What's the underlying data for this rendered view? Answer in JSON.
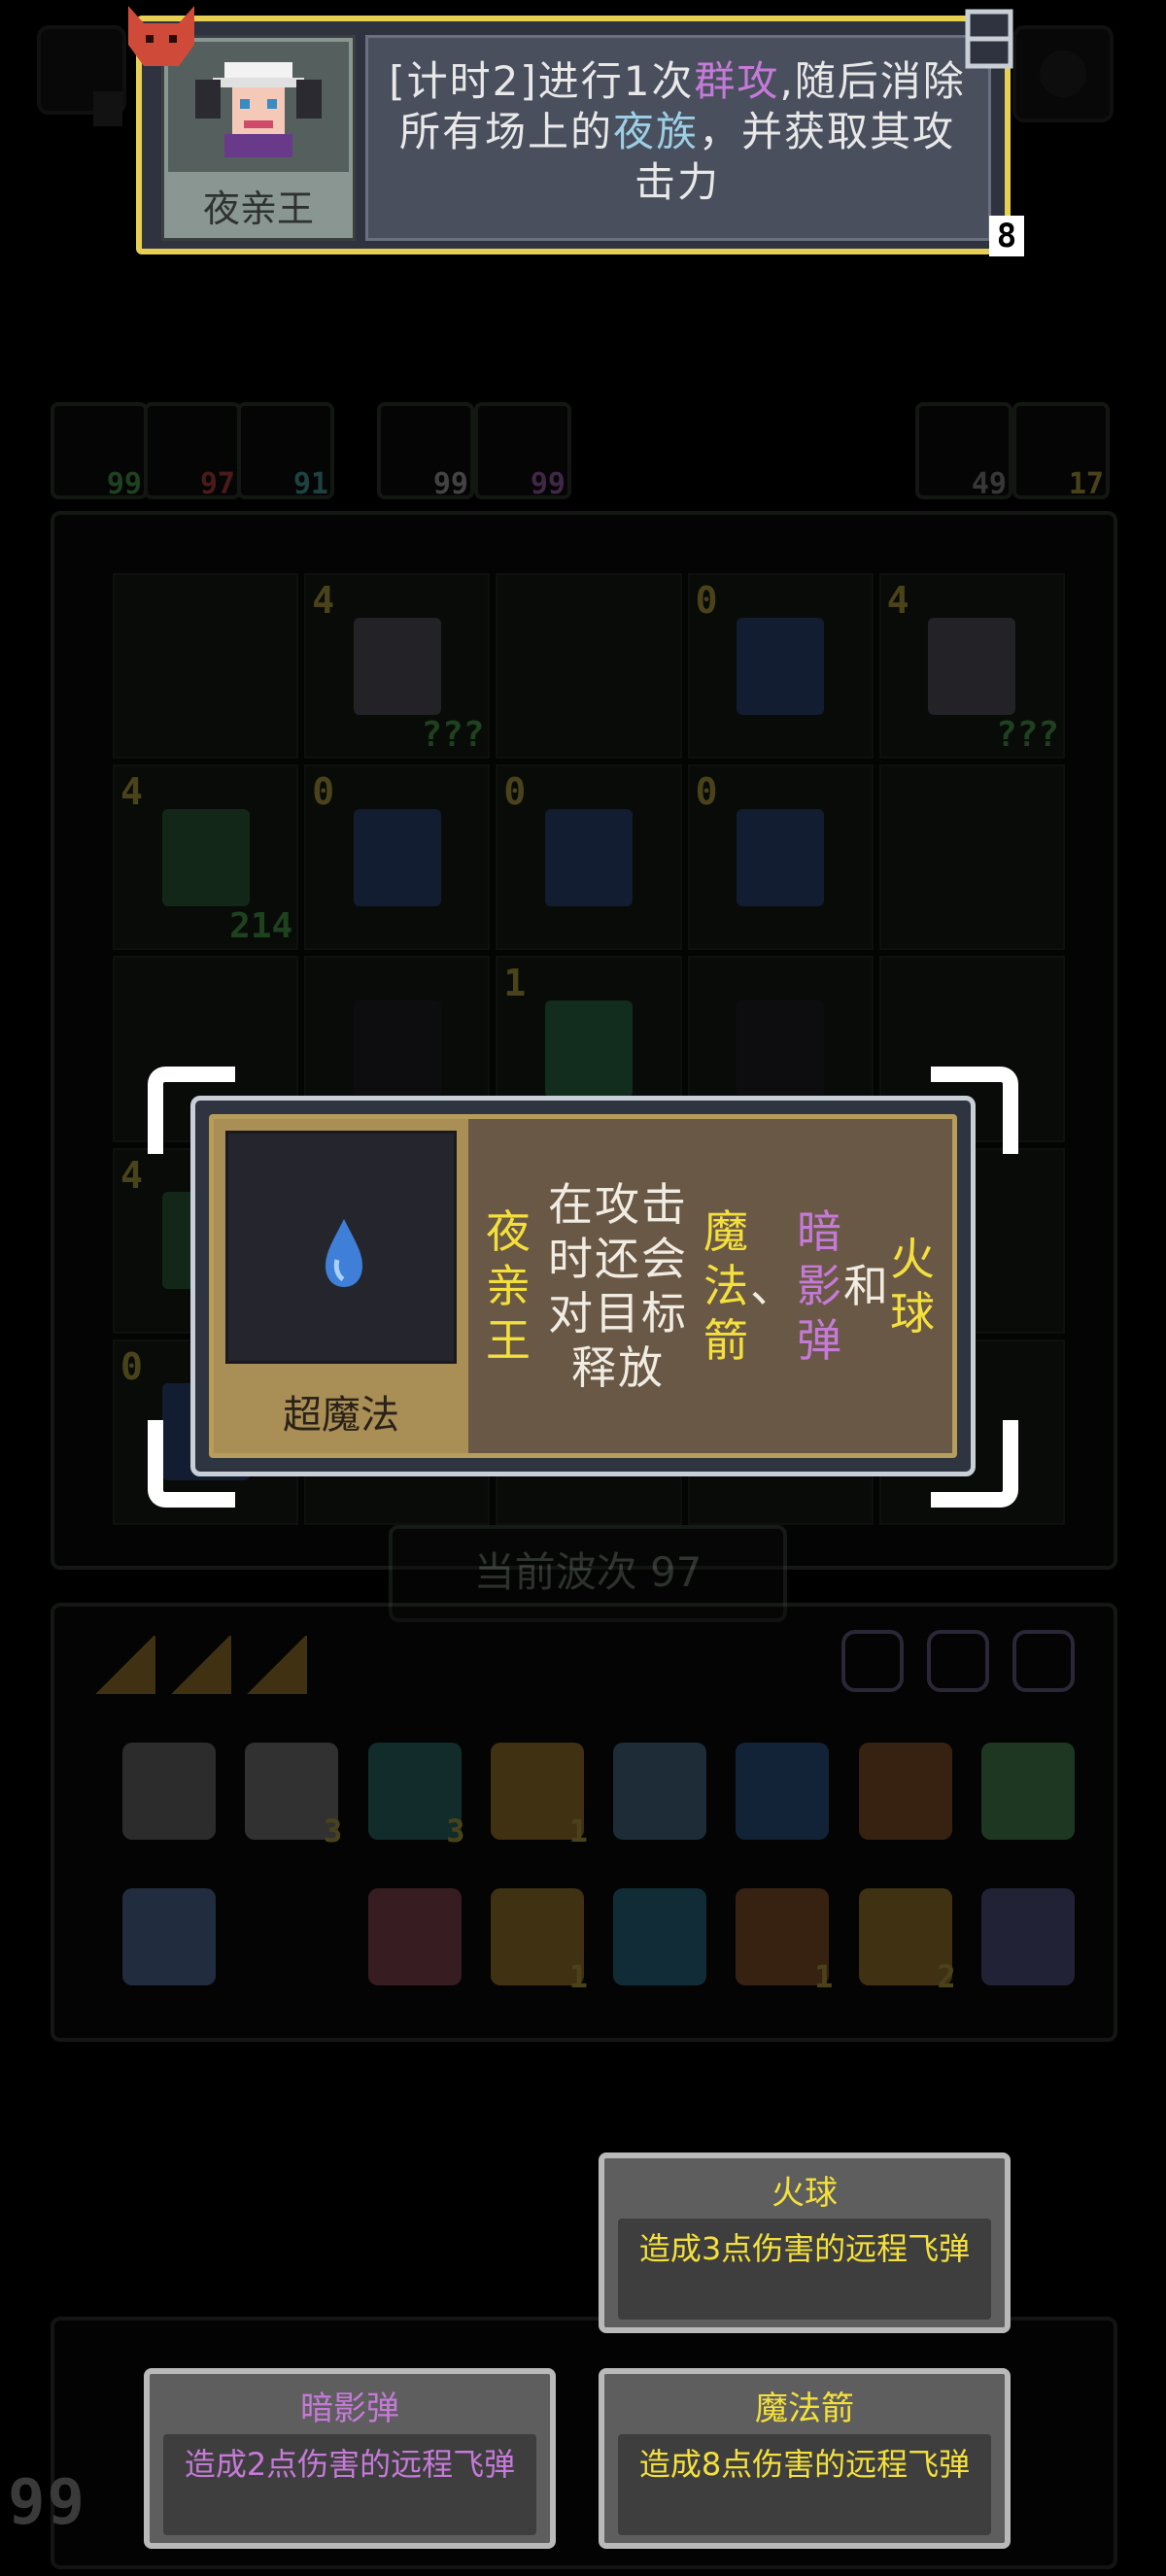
{
  "unit_card": {
    "name": "夜亲王",
    "skill_parts": [
      {
        "text": "[计时2]进行1次",
        "color": "#e8e8e8"
      },
      {
        "text": "群攻",
        "color": "#c57ad8"
      },
      {
        "text": ",随后消除所有场上的",
        "color": "#e8e8e8"
      },
      {
        "text": "夜族",
        "color": "#9ccfe4"
      },
      {
        "text": "，并获取其攻击力",
        "color": "#e8e8e8"
      }
    ],
    "corner_number": "8"
  },
  "stats": [
    {
      "value": "99",
      "color": "#5ec95e",
      "icon": "leaf-icon"
    },
    {
      "value": "97",
      "color": "#e55555",
      "icon": "plus-icon"
    },
    {
      "value": "91",
      "color": "#5ec9c9",
      "icon": "swirl-icon"
    },
    {
      "value": "99",
      "color": "#cccccc",
      "icon": "wing-icon"
    },
    {
      "value": "99",
      "color": "#c57ad8",
      "icon": "lightning-icon"
    },
    {
      "value": "49",
      "color": "#aaaaaa",
      "icon": "undo-icon"
    },
    {
      "value": "17",
      "color": "#e6cf52",
      "icon": "bolt-icon"
    }
  ],
  "board": {
    "cells": [
      {
        "lvl": "",
        "atk": "",
        "kind": "empty"
      },
      {
        "lvl": "4",
        "atk": "???",
        "kind": "knight"
      },
      {
        "lvl": "",
        "atk": "",
        "kind": "empty"
      },
      {
        "lvl": "0",
        "atk": "",
        "kind": "box"
      },
      {
        "lvl": "4",
        "atk": "???",
        "kind": "knight"
      },
      {
        "lvl": "4",
        "atk": "214",
        "kind": "knight-green"
      },
      {
        "lvl": "0",
        "atk": "",
        "kind": "box"
      },
      {
        "lvl": "0",
        "atk": "",
        "kind": "box"
      },
      {
        "lvl": "0",
        "atk": "",
        "kind": "box"
      },
      {
        "lvl": "",
        "atk": "",
        "kind": "empty"
      },
      {
        "lvl": "",
        "atk": "",
        "kind": "empty"
      },
      {
        "lvl": "",
        "atk": "",
        "kind": "shadow"
      },
      {
        "lvl": "1",
        "atk": "",
        "kind": "tower"
      },
      {
        "lvl": "",
        "atk": "",
        "kind": "shadow"
      },
      {
        "lvl": "",
        "atk": "",
        "kind": "empty"
      },
      {
        "lvl": "4",
        "atk": "",
        "kind": "knight-green"
      },
      {
        "lvl": "",
        "atk": "",
        "kind": "empty"
      },
      {
        "lvl": "",
        "atk": "",
        "kind": "empty"
      },
      {
        "lvl": "",
        "atk": "",
        "kind": "empty"
      },
      {
        "lvl": "",
        "atk": "",
        "kind": "empty"
      },
      {
        "lvl": "0",
        "atk": "",
        "kind": "box"
      },
      {
        "lvl": "",
        "atk": "",
        "kind": "empty"
      },
      {
        "lvl": "",
        "atk": "",
        "kind": "empty"
      },
      {
        "lvl": "",
        "atk": "",
        "kind": "empty"
      },
      {
        "lvl": "",
        "atk": "",
        "kind": "empty"
      }
    ]
  },
  "wave_label": "当前波次 97",
  "inventory": {
    "row1": [
      {
        "icon": "scroll-icon",
        "count": "",
        "color": "#8a8a8a"
      },
      {
        "icon": "paper-icon",
        "count": "3",
        "color": "#9a9a9a"
      },
      {
        "icon": "heart-gem-icon",
        "count": "3",
        "color": "#3a8a8a"
      },
      {
        "icon": "ring-icon",
        "count": "1",
        "color": "#c49a3a"
      },
      {
        "icon": "feather-icon",
        "count": "",
        "color": "#5a8aaa"
      },
      {
        "icon": "drop-icon",
        "count": "",
        "color": "#3a6aaa"
      },
      {
        "icon": "crown-icon",
        "count": "",
        "color": "#aa6a3a"
      },
      {
        "icon": "wand-icon",
        "count": "",
        "color": "#5aaa6a"
      }
    ],
    "row2": [
      {
        "icon": "flame-icon",
        "count": "",
        "color": "#6a8ac4"
      },
      {
        "icon": "empty-slot",
        "count": "",
        "color": "#0a0d0a"
      },
      {
        "icon": "arrow-icon",
        "count": "",
        "color": "#aa5a6a"
      },
      {
        "icon": "scroll-gold-icon",
        "count": "1",
        "color": "#c49a3a"
      },
      {
        "icon": "boot-icon",
        "count": "",
        "color": "#3a8aaa"
      },
      {
        "icon": "barrel-icon",
        "count": "1",
        "color": "#aa6a3a"
      },
      {
        "icon": "potion-icon",
        "count": "2",
        "color": "#c49a3a"
      },
      {
        "icon": "key-icon",
        "count": "",
        "color": "#6a6aaa"
      }
    ]
  },
  "tooltip": {
    "item_name": "超魔法",
    "desc_parts": [
      {
        "text": "夜亲王",
        "color": "#f4e03c"
      },
      {
        "text": "在攻击时还会对目标释放",
        "color": "#f0ece2"
      },
      {
        "text": "魔法箭",
        "color": "#f4e03c"
      },
      {
        "text": "、",
        "color": "#f0ece2"
      },
      {
        "text": "暗影弹",
        "color": "#c57ad8"
      },
      {
        "text": "和",
        "color": "#f0ece2"
      },
      {
        "text": "火球",
        "color": "#f4e03c"
      }
    ]
  },
  "choices": {
    "fire": {
      "title": "火球",
      "body": "造成3点伤害的远程飞弹",
      "color": "#f4e03c"
    },
    "shadow": {
      "title": "暗影弹",
      "body": "造成2点伤害的远程飞弹",
      "color": "#c57ad8"
    },
    "arrow": {
      "title": "魔法箭",
      "body": "造成8点伤害的远程飞弹",
      "color": "#f4e03c"
    }
  },
  "level_display": "99"
}
